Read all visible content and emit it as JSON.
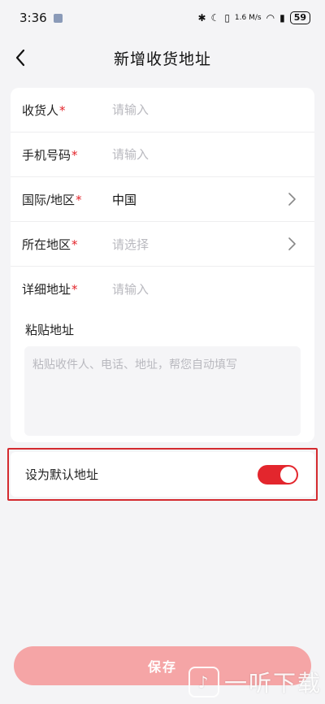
{
  "status_bar": {
    "time": "3:36",
    "network_speed": "1.6 M/s",
    "battery": "59"
  },
  "nav": {
    "title": "新增收货地址"
  },
  "form": {
    "rows": [
      {
        "label": "收货人",
        "required_mark": "*",
        "placeholder": "请输入"
      },
      {
        "label": "手机号码",
        "required_mark": "*",
        "placeholder": "请输入"
      },
      {
        "label": "国际/地区",
        "required_mark": "*",
        "value": "中国"
      },
      {
        "label": "所在地区",
        "required_mark": "*",
        "placeholder": "请选择"
      },
      {
        "label": "详细地址",
        "required_mark": "*",
        "placeholder": "请输入"
      }
    ],
    "paste": {
      "title": "粘贴地址",
      "placeholder": "粘贴收件人、电话、地址，帮您自动填写"
    }
  },
  "default_address": {
    "label": "设为默认地址",
    "enabled": true
  },
  "save_button": {
    "label": "保存"
  },
  "watermark": {
    "text": "一听下载"
  },
  "colors": {
    "accent": "#e3262d",
    "save_disabled": "#f5a5a6",
    "background": "#f4f4f6"
  }
}
